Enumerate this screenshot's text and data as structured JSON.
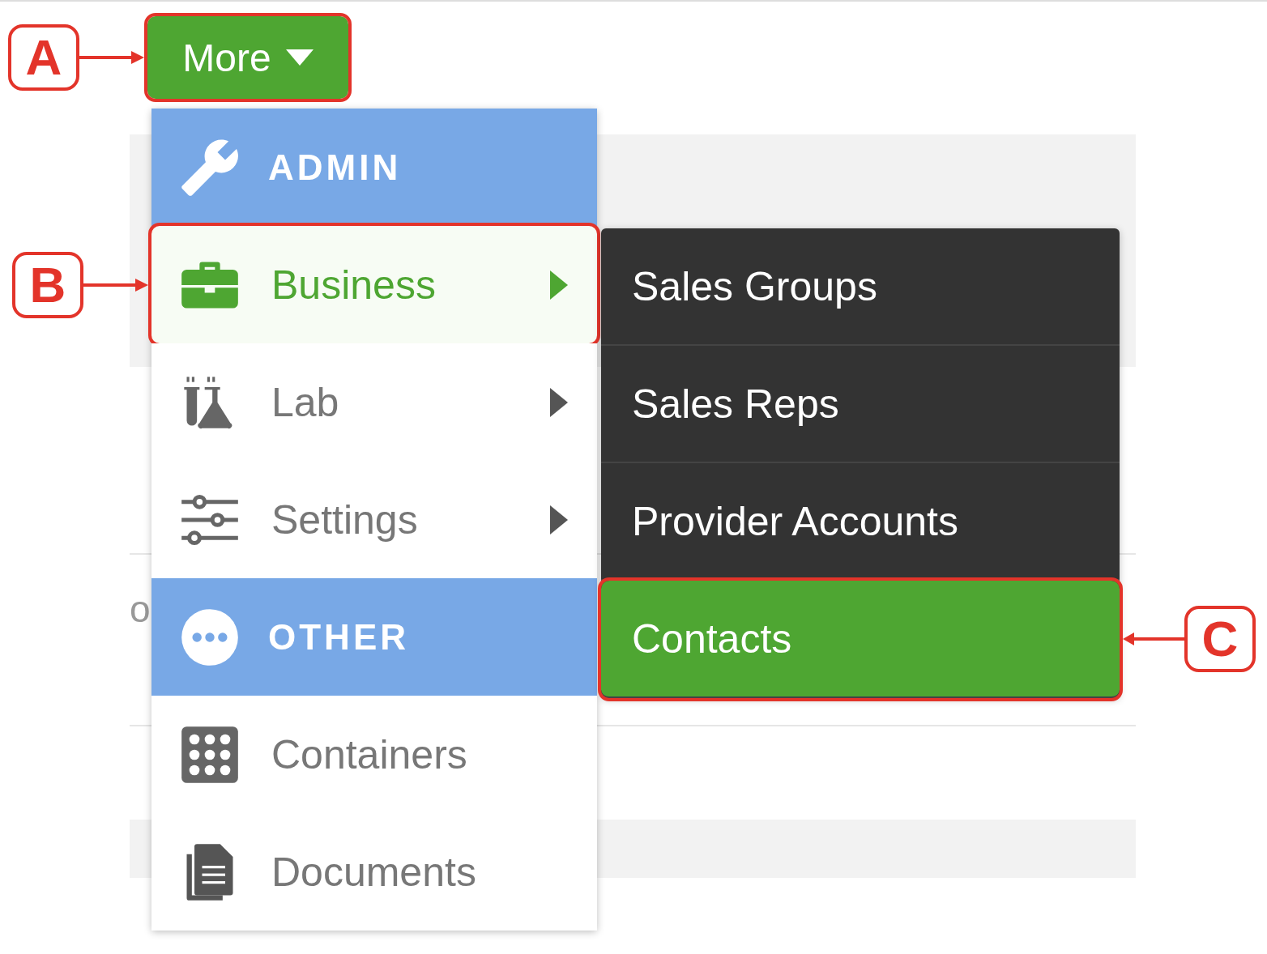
{
  "more_button": {
    "label": "More",
    "callout": "A"
  },
  "background_fragment": "o",
  "menu": [
    {
      "kind": "header",
      "label": "ADMIN"
    },
    {
      "kind": "item",
      "label": "Business",
      "selected": true,
      "has_submenu": true,
      "callout": "B"
    },
    {
      "kind": "item",
      "label": "Lab",
      "selected": false,
      "has_submenu": true
    },
    {
      "kind": "item",
      "label": "Settings",
      "selected": false,
      "has_submenu": true
    },
    {
      "kind": "header",
      "label": "OTHER"
    },
    {
      "kind": "item",
      "label": "Containers",
      "selected": false,
      "has_submenu": false
    },
    {
      "kind": "item",
      "label": "Documents",
      "selected": false,
      "has_submenu": false
    }
  ],
  "submenu": [
    {
      "label": "Sales Groups",
      "selected": false
    },
    {
      "label": "Sales Reps",
      "selected": false
    },
    {
      "label": "Provider Accounts",
      "selected": false
    },
    {
      "label": "Contacts",
      "selected": true,
      "callout": "C"
    }
  ]
}
